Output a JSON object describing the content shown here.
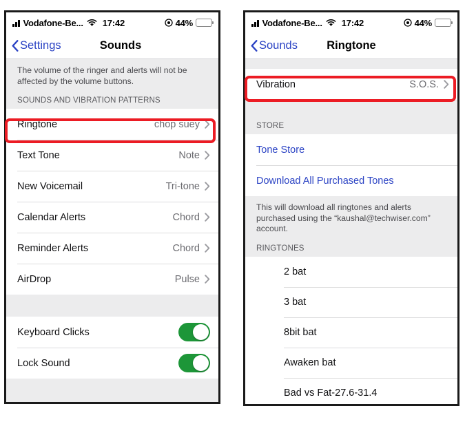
{
  "colors": {
    "accent_blue": "#2b43c4",
    "toggle_green": "#1d9638",
    "highlight_red": "#ec1c24",
    "group_background": "#ececed"
  },
  "left_phone": {
    "status_bar": {
      "signal_icon": "cellular-signal-icon",
      "carrier": "Vodafone-Be...",
      "wifi_icon": "wifi-icon",
      "time": "17:42",
      "location_icon": "location-services-icon",
      "battery_percent": "44%",
      "battery_level": 44,
      "battery_icon": "battery-icon"
    },
    "nav": {
      "back_label": "Settings",
      "back_icon": "chevron-left-icon",
      "title": "Sounds"
    },
    "footnote": "The volume of the ringer and alerts will not be affected by the volume buttons.",
    "section_header": "SOUNDS AND VIBRATION PATTERNS",
    "rows": [
      {
        "label": "Ringtone",
        "value": "chop suey"
      },
      {
        "label": "Text Tone",
        "value": "Note"
      },
      {
        "label": "New Voicemail",
        "value": "Tri-tone"
      },
      {
        "label": "Calendar Alerts",
        "value": "Chord"
      },
      {
        "label": "Reminder Alerts",
        "value": "Chord"
      },
      {
        "label": "AirDrop",
        "value": "Pulse"
      }
    ],
    "toggles": [
      {
        "label": "Keyboard Clicks",
        "state": "on"
      },
      {
        "label": "Lock Sound",
        "state": "on"
      }
    ]
  },
  "right_phone": {
    "status_bar": {
      "signal_icon": "cellular-signal-icon",
      "carrier": "Vodafone-Be...",
      "wifi_icon": "wifi-icon",
      "time": "17:42",
      "location_icon": "location-services-icon",
      "battery_percent": "44%",
      "battery_level": 44,
      "battery_icon": "battery-icon"
    },
    "nav": {
      "back_label": "Sounds",
      "back_icon": "chevron-left-icon",
      "title": "Ringtone"
    },
    "vibration_row": {
      "label": "Vibration",
      "value": "S.O.S."
    },
    "store_header": "STORE",
    "store_links": [
      {
        "label": "Tone Store"
      },
      {
        "label": "Download All Purchased Tones"
      }
    ],
    "store_footnote": "This will download all ringtones and alerts purchased using the “kaushal@techwiser.com” account.",
    "ringtones_header": "RINGTONES",
    "ringtones": [
      {
        "label": "2 bat"
      },
      {
        "label": "3 bat"
      },
      {
        "label": "8bit bat"
      },
      {
        "label": "Awaken bat"
      },
      {
        "label": "Bad vs Fat-27.6-31.4"
      }
    ]
  }
}
